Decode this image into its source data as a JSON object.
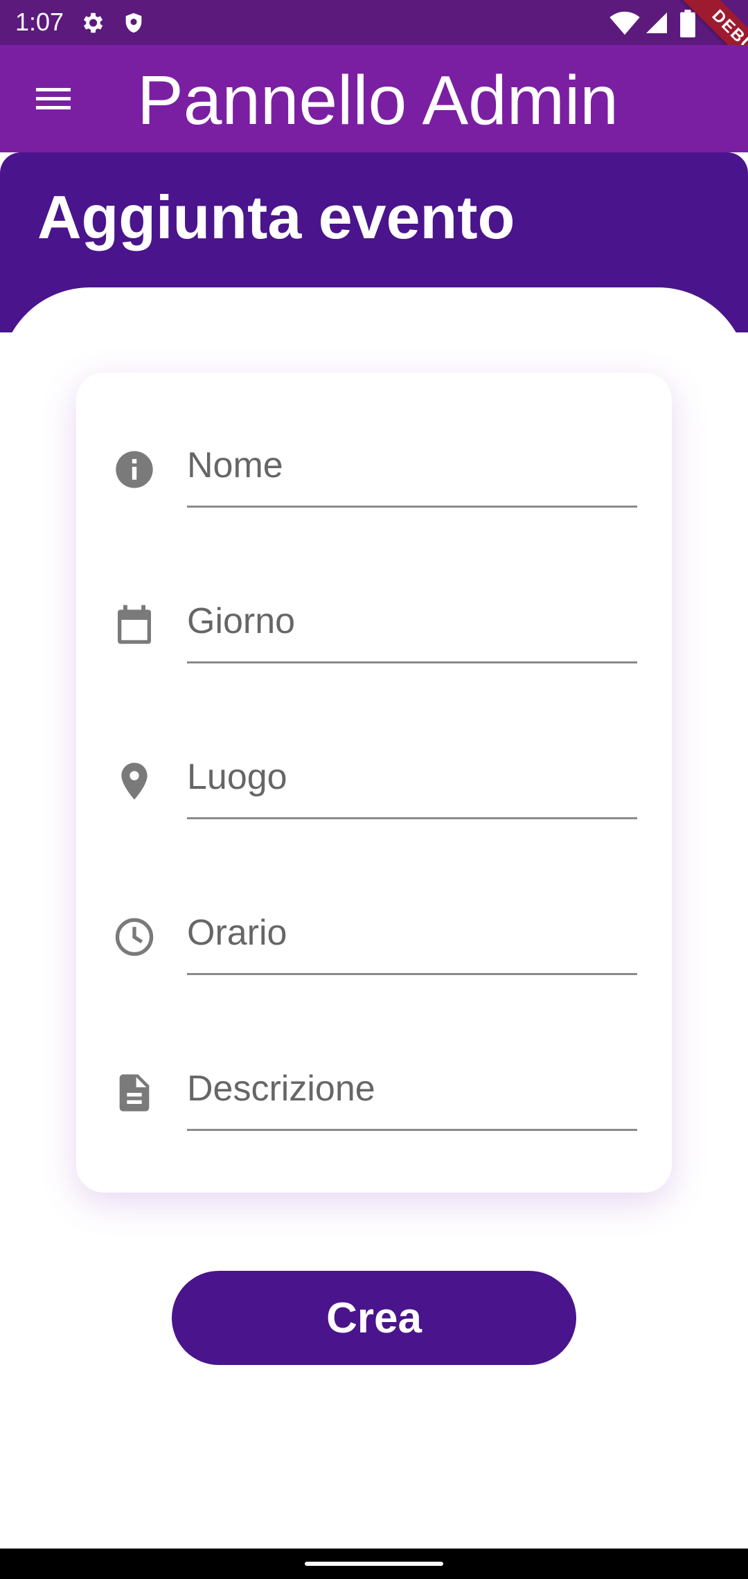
{
  "status_bar": {
    "time": "1:07",
    "icons": [
      "gear-icon",
      "shield-icon",
      "wifi-icon",
      "signal-icon",
      "battery-icon"
    ]
  },
  "debug_banner": {
    "label": "DEBUG"
  },
  "app_bar": {
    "title": "Pannello Admin",
    "menu_icon": "hamburger-menu-icon",
    "color": "#7b1fa2"
  },
  "header": {
    "title": "Aggiunta evento",
    "color": "#4a148c"
  },
  "form": {
    "fields": [
      {
        "icon": "info-icon",
        "placeholder": "Nome",
        "value": ""
      },
      {
        "icon": "calendar-icon",
        "placeholder": "Giorno",
        "value": ""
      },
      {
        "icon": "location-pin-icon",
        "placeholder": "Luogo",
        "value": ""
      },
      {
        "icon": "clock-icon",
        "placeholder": "Orario",
        "value": ""
      },
      {
        "icon": "document-icon",
        "placeholder": "Descrizione",
        "value": ""
      }
    ]
  },
  "actions": {
    "create_label": "Crea",
    "button_color": "#4a148c"
  }
}
